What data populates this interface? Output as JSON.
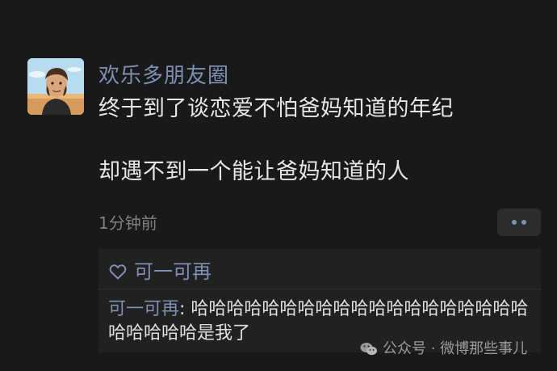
{
  "moment": {
    "username": "欢乐多朋友圈",
    "content_line_1": "终于到了谈恋爱不怕爸妈知道的年纪",
    "content_line_2": "却遇不到一个能让爸妈知道的人",
    "time": "1分钟前",
    "more_icon": "more-dots-icon"
  },
  "interactions": {
    "like_icon": "heart-icon",
    "likes": [
      "可一可再"
    ],
    "comments": [
      {
        "author": "可一可再",
        "separator": ": ",
        "text": "哈哈哈哈哈哈哈哈哈哈哈哈哈哈哈哈哈哈哈哈哈哈哈哈是我了"
      }
    ]
  },
  "watermark": {
    "icon": "wechat-icon",
    "text": "公众号 · 微博那些事儿"
  },
  "colors": {
    "background": "#191919",
    "accent": "#7d8fb3",
    "text": "#e6e6e6",
    "muted": "#808080",
    "panel": "#212121"
  }
}
